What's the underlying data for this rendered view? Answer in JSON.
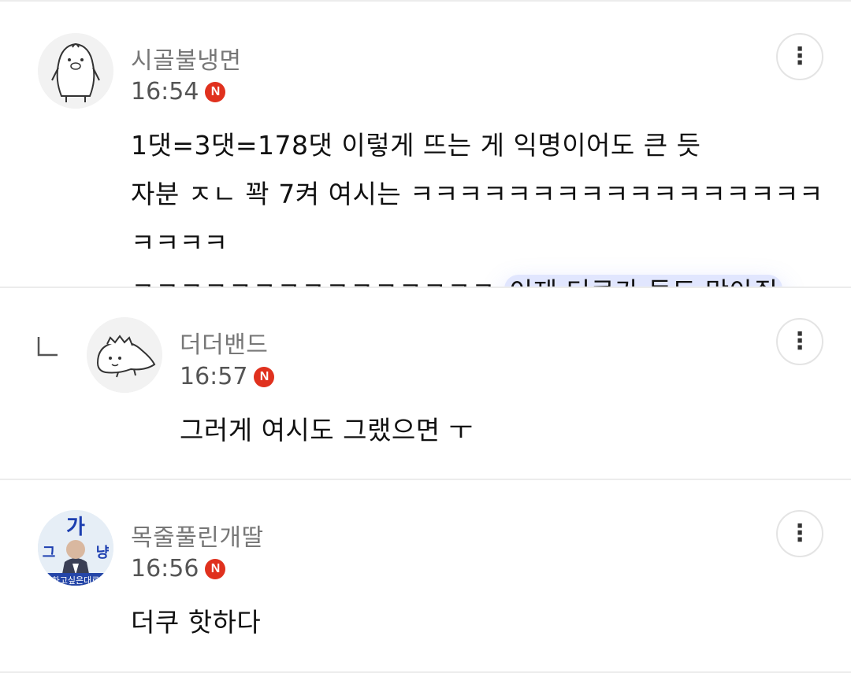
{
  "comments": [
    {
      "nickname": "시골불냉면",
      "time": "16:54",
      "badge": "N",
      "lines": [
        "1댓=3댓=178댓 이렇게 뜨는 게 익명이어도 큰 듯",
        "자분 ㅈㄴ 꽉 7켜 여시는 ㅋㅋㅋㅋㅋㅋㅋㅋㅋㅋㅋㅋㅋㅋㅋㅋㅋㅋㅋㅋㅋ"
      ],
      "line3_plain": "ㅋㅋㅋㅋㅋㅋㅋㅋㅋㅋㅋㅋㅋㅋㅋ ",
      "line3_highlight": "이제 더쿠가 돌도 막아줘",
      "avatar_icon": "penguin-avatar-icon"
    },
    {
      "nickname": "더더밴드",
      "time": "16:57",
      "badge": "N",
      "text": "그러게 여시도 그랬으면 ㅜ",
      "avatar_icon": "creature-avatar-icon",
      "is_reply": true
    },
    {
      "nickname": "목줄풀린개딸",
      "time": "16:56",
      "badge": "N",
      "text": "더쿠 핫하다",
      "avatar_icon": "photo-avatar-icon",
      "avatar_text": {
        "top": "가",
        "left": "그",
        "right": "냥",
        "bottom": "하고싶은대로"
      }
    }
  ],
  "more_glyph": "⋮",
  "colors": {
    "badge": "#e0311e",
    "highlight": "#788cfa",
    "divider": "#ececec"
  }
}
